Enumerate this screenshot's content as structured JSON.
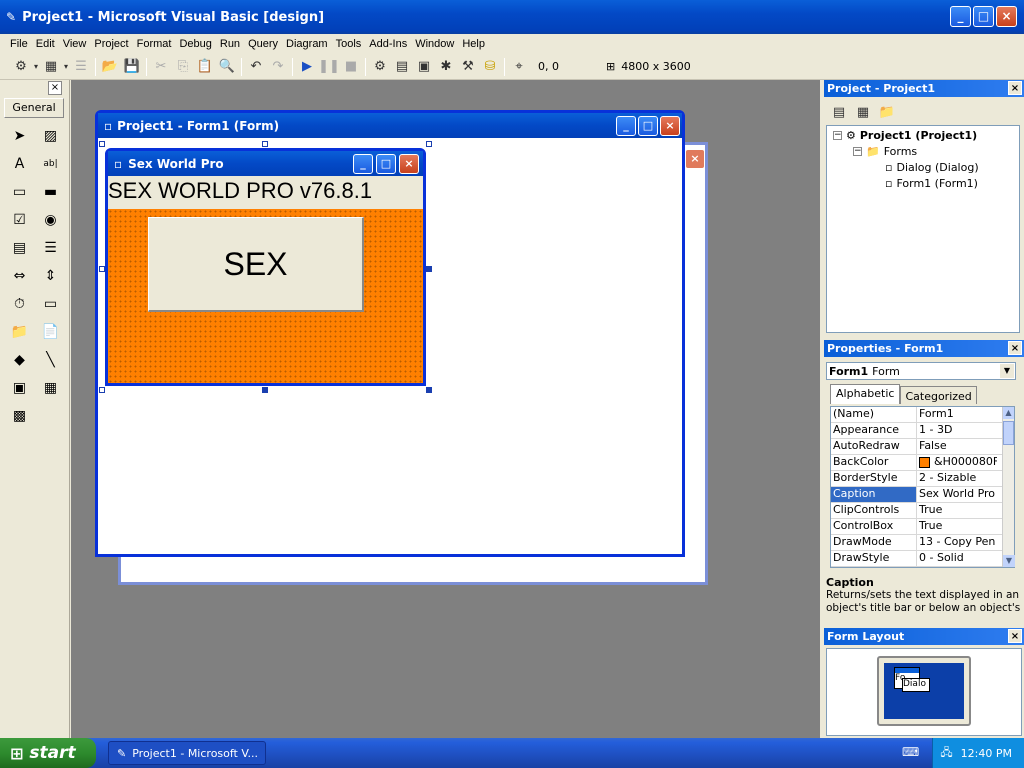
{
  "app": {
    "title": "Project1 - Microsoft Visual Basic [design]",
    "window_buttons": [
      "_",
      "□",
      "×"
    ]
  },
  "menu": [
    "File",
    "Edit",
    "View",
    "Project",
    "Format",
    "Debug",
    "Run",
    "Query",
    "Diagram",
    "Tools",
    "Add-Ins",
    "Window",
    "Help"
  ],
  "toolbar": {
    "coords": "0, 0",
    "size": "4800 x 3600"
  },
  "toolbox": {
    "tab_label": "General",
    "icons": [
      "pointer-icon",
      "picture-box-icon",
      "label-icon",
      "textbox-icon",
      "frame-icon",
      "command-button-icon",
      "checkbox-icon",
      "option-button-icon",
      "combobox-icon",
      "listbox-icon",
      "hscrollbar-icon",
      "vscrollbar-icon",
      "timer-icon",
      "drivelistbox-icon",
      "dirlistbox-icon",
      "filelistbox-icon",
      "shape-icon",
      "line-icon",
      "image-icon",
      "data-icon",
      "ole-icon"
    ]
  },
  "form_designer": {
    "title": "Project1 - Form1 (Form)"
  },
  "app_form": {
    "title": "Sex World Pro",
    "heading": "SEX WORLD PRO v76.8.1",
    "button_label": "SEX",
    "backcolor": "#ff8000"
  },
  "project_explorer": {
    "title": "Project - Project1",
    "tree": {
      "root": "Project1 (Project1)",
      "folder": "Forms",
      "items": [
        "Dialog (Dialog)",
        "Form1 (Form1)"
      ]
    }
  },
  "properties": {
    "title": "Properties - Form1",
    "object_name": "Form1",
    "object_type": "Form",
    "tabs": [
      "Alphabetic",
      "Categorized"
    ],
    "rows": [
      {
        "name": "(Name)",
        "value": "Form1"
      },
      {
        "name": "Appearance",
        "value": "1 - 3D"
      },
      {
        "name": "AutoRedraw",
        "value": "False"
      },
      {
        "name": "BackColor",
        "value": "&H000080FF"
      },
      {
        "name": "BorderStyle",
        "value": "2 - Sizable"
      },
      {
        "name": "Caption",
        "value": "Sex World Pro"
      },
      {
        "name": "ClipControls",
        "value": "True"
      },
      {
        "name": "ControlBox",
        "value": "True"
      },
      {
        "name": "DrawMode",
        "value": "13 - Copy Pen"
      },
      {
        "name": "DrawStyle",
        "value": "0 - Solid"
      }
    ],
    "selected_index": 5,
    "desc_title": "Caption",
    "desc_text": "Returns/sets the text displayed in an object's title bar or below an object's"
  },
  "form_layout": {
    "title": "Form Layout",
    "preview_labels": [
      "Fo",
      "Dialo"
    ]
  },
  "taskbar": {
    "start_label": "start",
    "task_label": "Project1 - Microsoft V...",
    "clock": "12:40 PM"
  }
}
